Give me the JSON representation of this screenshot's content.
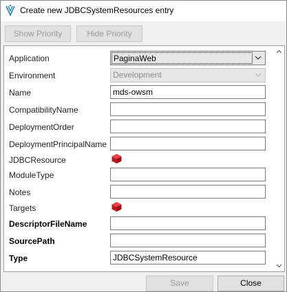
{
  "window": {
    "title": "Create new JDBCSystemResources entry"
  },
  "toolbar": {
    "show_priority": "Show Priority",
    "hide_priority": "Hide Priority"
  },
  "form": {
    "application": {
      "label": "Application",
      "value": "PaginaWeb"
    },
    "environment": {
      "label": "Environment",
      "value": "Development"
    },
    "name": {
      "label": "Name",
      "value": "mds-owsm"
    },
    "compatibility_name": {
      "label": "CompatibilityName",
      "value": ""
    },
    "deployment_order": {
      "label": "DeploymentOrder",
      "value": ""
    },
    "deployment_principal_name": {
      "label": "DeploymentPrincipalName",
      "value": ""
    },
    "jdbc_resource": {
      "label": "JDBCResource",
      "icon": "red-cube-icon"
    },
    "module_type": {
      "label": "ModuleType",
      "value": ""
    },
    "notes": {
      "label": "Notes",
      "value": ""
    },
    "targets": {
      "label": "Targets",
      "icon": "red-cube-icon"
    },
    "descriptor_file_name": {
      "label": "DescriptorFileName",
      "value": ""
    },
    "source_path": {
      "label": "SourcePath",
      "value": ""
    },
    "type": {
      "label": "Type",
      "value": "JDBCSystemResource"
    }
  },
  "footer": {
    "save": "Save",
    "close": "Close"
  },
  "colors": {
    "cube_red": "#d0202a",
    "disabled_text": "#9a9a9a"
  }
}
